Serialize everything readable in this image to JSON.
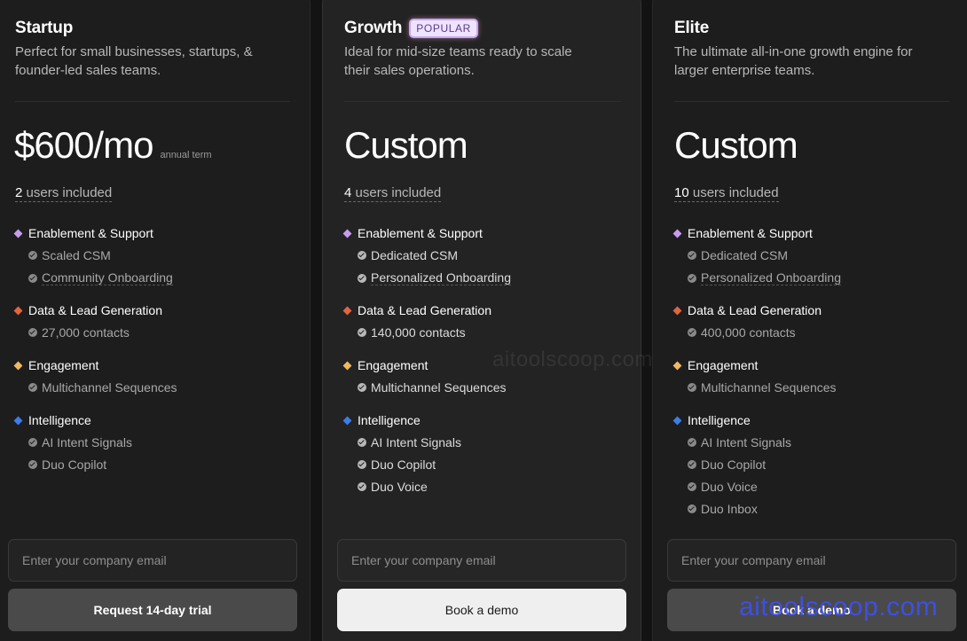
{
  "plans": [
    {
      "name": "Startup",
      "badge": "",
      "description": "Perfect for small businesses, startups, & founder-led sales teams.",
      "price": "$600/mo",
      "price_note": "annual term",
      "users_count": "2",
      "users_label": "users included",
      "groups": [
        {
          "title": "Enablement & Support",
          "color": "#c79cf0",
          "items": [
            "Scaled CSM",
            "Community Onboarding"
          ]
        },
        {
          "title": "Data & Lead Generation",
          "color": "#e0663d",
          "items": [
            "27,000 contacts"
          ]
        },
        {
          "title": "Engagement",
          "color": "#f0b863",
          "items": [
            "Multichannel Sequences"
          ]
        },
        {
          "title": "Intelligence",
          "color": "#3a7ee8",
          "items": [
            "AI Intent Signals",
            "Duo Copilot"
          ]
        }
      ],
      "email_placeholder": "Enter your company email",
      "cta_label": "Request 14-day trial"
    },
    {
      "name": "Growth",
      "badge": "POPULAR",
      "description": "Ideal for mid-size teams ready to scale their sales operations.",
      "price": "Custom",
      "price_note": "",
      "users_count": "4",
      "users_label": "users included",
      "groups": [
        {
          "title": "Enablement & Support",
          "color": "#c79cf0",
          "items": [
            "Dedicated CSM",
            "Personalized Onboarding"
          ]
        },
        {
          "title": "Data & Lead Generation",
          "color": "#e0663d",
          "items": [
            "140,000 contacts"
          ]
        },
        {
          "title": "Engagement",
          "color": "#f0b863",
          "items": [
            "Multichannel Sequences"
          ]
        },
        {
          "title": "Intelligence",
          "color": "#3a7ee8",
          "items": [
            "AI Intent Signals",
            "Duo Copilot",
            "Duo Voice"
          ]
        }
      ],
      "email_placeholder": "Enter your company email",
      "cta_label": "Book a demo"
    },
    {
      "name": "Elite",
      "badge": "",
      "description": "The ultimate all-in-one growth engine for larger enterprise teams.",
      "price": "Custom",
      "price_note": "",
      "users_count": "10",
      "users_label": "users included",
      "groups": [
        {
          "title": "Enablement & Support",
          "color": "#c79cf0",
          "items": [
            "Dedicated CSM",
            "Personalized Onboarding"
          ]
        },
        {
          "title": "Data & Lead Generation",
          "color": "#e0663d",
          "items": [
            "400,000 contacts"
          ]
        },
        {
          "title": "Engagement",
          "color": "#f0b863",
          "items": [
            "Multichannel Sequences"
          ]
        },
        {
          "title": "Intelligence",
          "color": "#3a7ee8",
          "items": [
            "AI Intent Signals",
            "Duo Copilot",
            "Duo Voice",
            "Duo Inbox"
          ]
        }
      ],
      "email_placeholder": "Enter your company email",
      "cta_label": "Book a demo"
    }
  ],
  "watermark": "aitoolscoop.com",
  "watermark_overlay": "aitoolscoop.com"
}
